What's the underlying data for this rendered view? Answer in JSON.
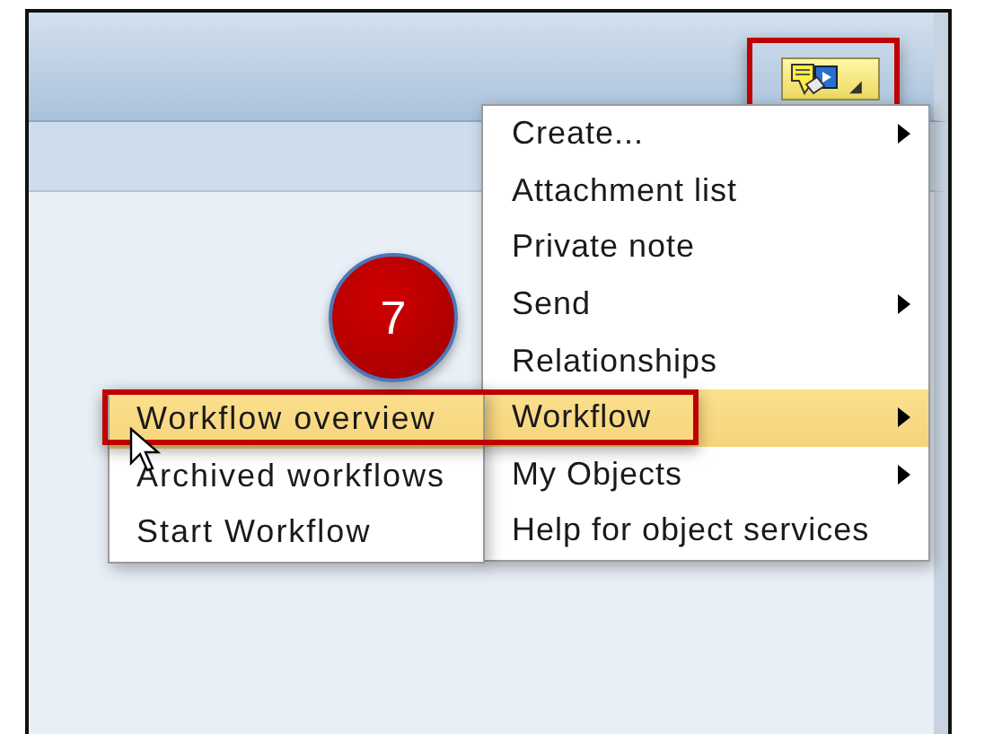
{
  "toolbar": {
    "object_services_button": {
      "caret": "◢"
    }
  },
  "menu": {
    "items": [
      {
        "label": "Create...",
        "has_submenu": true,
        "selected": false
      },
      {
        "label": "Attachment list",
        "has_submenu": false,
        "selected": false
      },
      {
        "label": "Private note",
        "has_submenu": false,
        "selected": false
      },
      {
        "label": "Send",
        "has_submenu": true,
        "selected": false
      },
      {
        "label": "Relationships",
        "has_submenu": false,
        "selected": false
      },
      {
        "label": "Workflow",
        "has_submenu": true,
        "selected": true
      },
      {
        "label": "My Objects",
        "has_submenu": true,
        "selected": false
      },
      {
        "label": "Help for object services",
        "has_submenu": false,
        "selected": false
      }
    ]
  },
  "submenu": {
    "items": [
      {
        "label": "Workflow overview",
        "selected": true
      },
      {
        "label": "Archived workflows",
        "selected": false
      },
      {
        "label": "Start Workflow",
        "selected": false
      }
    ]
  },
  "callout": {
    "step": "7"
  }
}
